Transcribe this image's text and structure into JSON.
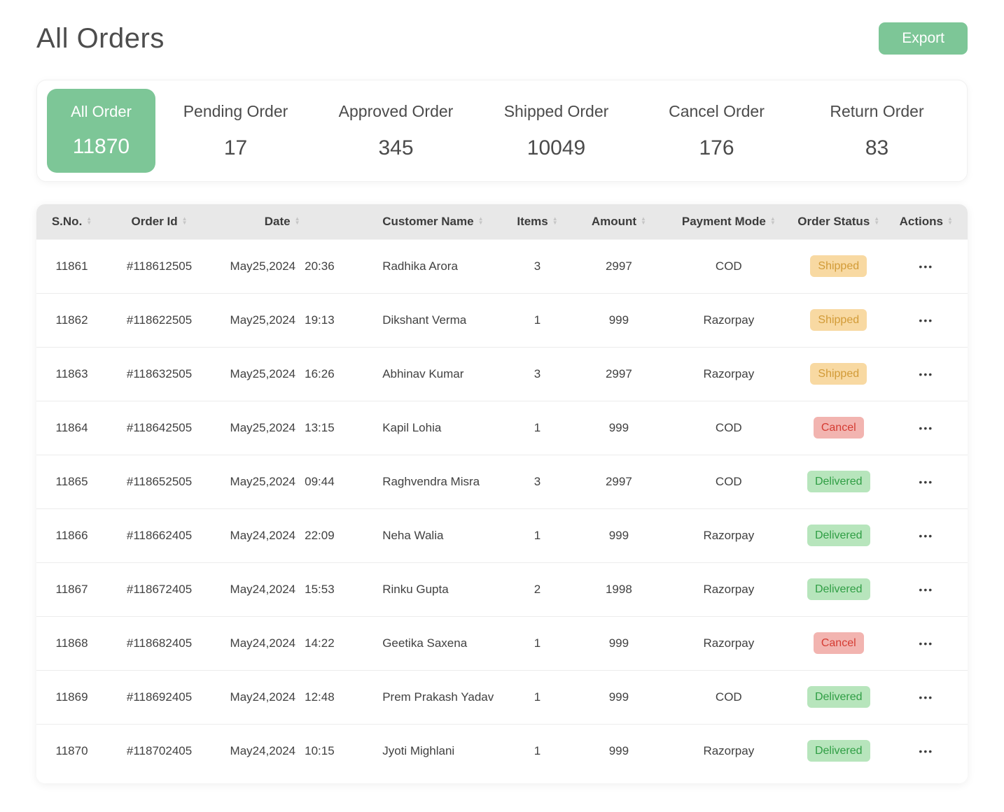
{
  "page": {
    "title": "All Orders",
    "export_label": "Export"
  },
  "colors": {
    "accent": "#7DC697",
    "badge_shipped_bg": "#F8D9A2",
    "badge_shipped_text": "#D29B37",
    "badge_cancel_bg": "#F2B4B0",
    "badge_cancel_text": "#D53C33",
    "badge_delivered_bg": "#B7E5BC",
    "badge_delivered_text": "#2F9E44"
  },
  "icons": {
    "ellipsis": "•••",
    "sort_up": "▲",
    "sort_down": "▼"
  },
  "summary": {
    "cards": [
      {
        "label": "All Order",
        "value": "11870",
        "active": true
      },
      {
        "label": "Pending Order",
        "value": "17",
        "active": false
      },
      {
        "label": "Approved Order",
        "value": "345",
        "active": false
      },
      {
        "label": "Shipped Order",
        "value": "10049",
        "active": false
      },
      {
        "label": "Cancel Order",
        "value": "176",
        "active": false
      },
      {
        "label": "Return Order",
        "value": "83",
        "active": false
      }
    ]
  },
  "table": {
    "columns": [
      "S.No.",
      "Order Id",
      "Date",
      "Customer Name",
      "Items",
      "Amount",
      "Payment Mode",
      "Order Status",
      "Actions"
    ],
    "rows": [
      {
        "sno": "11861",
        "order_id": "#118612505",
        "date": "May25,2024",
        "time": "20:36",
        "customer": "Radhika Arora",
        "items": "3",
        "amount": "2997",
        "payment": "COD",
        "status": "Shipped"
      },
      {
        "sno": "11862",
        "order_id": "#118622505",
        "date": "May25,2024",
        "time": "19:13",
        "customer": "Dikshant Verma",
        "items": "1",
        "amount": "999",
        "payment": "Razorpay",
        "status": "Shipped"
      },
      {
        "sno": "11863",
        "order_id": "#118632505",
        "date": "May25,2024",
        "time": "16:26",
        "customer": "Abhinav Kumar",
        "items": "3",
        "amount": "2997",
        "payment": "Razorpay",
        "status": "Shipped"
      },
      {
        "sno": "11864",
        "order_id": "#118642505",
        "date": "May25,2024",
        "time": "13:15",
        "customer": "Kapil Lohia",
        "items": "1",
        "amount": "999",
        "payment": "COD",
        "status": "Cancel"
      },
      {
        "sno": "11865",
        "order_id": "#118652505",
        "date": "May25,2024",
        "time": "09:44",
        "customer": "Raghvendra Misra",
        "items": "3",
        "amount": "2997",
        "payment": "COD",
        "status": "Delivered"
      },
      {
        "sno": "11866",
        "order_id": "#118662405",
        "date": "May24,2024",
        "time": "22:09",
        "customer": "Neha Walia",
        "items": "1",
        "amount": "999",
        "payment": "Razorpay",
        "status": "Delivered"
      },
      {
        "sno": "11867",
        "order_id": "#118672405",
        "date": "May24,2024",
        "time": "15:53",
        "customer": "Rinku Gupta",
        "items": "2",
        "amount": "1998",
        "payment": "Razorpay",
        "status": "Delivered"
      },
      {
        "sno": "11868",
        "order_id": "#118682405",
        "date": "May24,2024",
        "time": "14:22",
        "customer": "Geetika Saxena",
        "items": "1",
        "amount": "999",
        "payment": "Razorpay",
        "status": "Cancel"
      },
      {
        "sno": "11869",
        "order_id": "#118692405",
        "date": "May24,2024",
        "time": "12:48",
        "customer": "Prem Prakash Yadav",
        "items": "1",
        "amount": "999",
        "payment": "COD",
        "status": "Delivered"
      },
      {
        "sno": "11870",
        "order_id": "#118702405",
        "date": "May24,2024",
        "time": "10:15",
        "customer": "Jyoti Mighlani",
        "items": "1",
        "amount": "999",
        "payment": "Razorpay",
        "status": "Delivered"
      }
    ]
  }
}
